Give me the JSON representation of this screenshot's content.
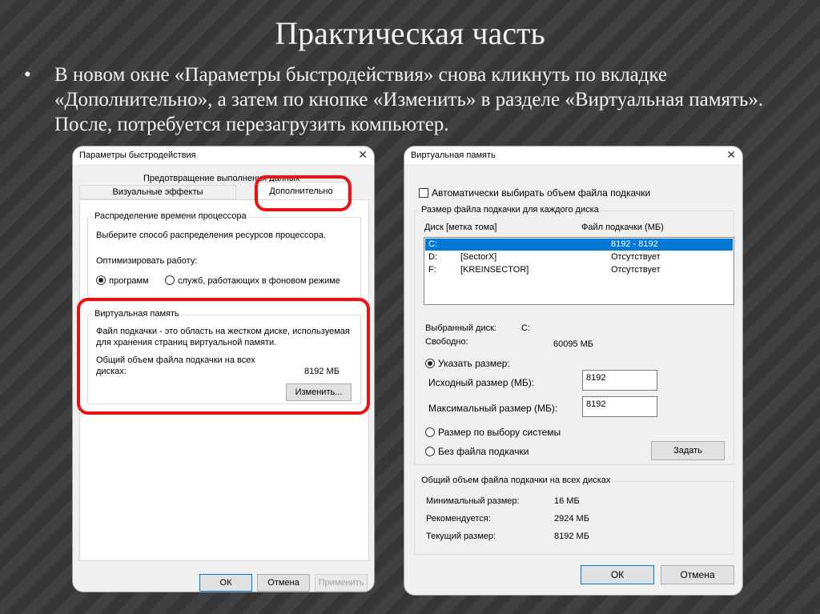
{
  "slide": {
    "title": "Практическая часть",
    "bullet_marker": "•",
    "bullet_text": "В новом окне «Параметры быстродействия» снова кликнуть по вкладке «Дополнительно», а затем по кнопке «Изменить» в разделе «Виртуальная память». После, потребуется перезагрузить компьютер."
  },
  "perf_window": {
    "title": "Параметры быстродействия",
    "close": "✕",
    "tabs": {
      "dep": "Предотвращение выполнения данных",
      "visual": "Визуальные эффекты",
      "advanced": "Дополнительно"
    },
    "cpu_group": {
      "label": "Распределение времени процессора",
      "description": "Выберите способ распределения ресурсов процессора.",
      "optimize_label": "Оптимизировать работу:",
      "option_programs": "программ",
      "option_services": "служб, работающих в фоновом режиме"
    },
    "vm_group": {
      "label": "Виртуальная память",
      "description_line1": "Файл подкачки - это область на жестком диске, используемая",
      "description_line2": "для хранения страниц виртуальной памяти.",
      "total_line1": "Общий объем файла подкачки на всех",
      "total_line2": "дисках:",
      "total_value": "8192 МБ",
      "change_button": "Изменить..."
    },
    "buttons": {
      "ok": "ОК",
      "cancel": "Отмена",
      "apply": "Применить"
    }
  },
  "vm_window": {
    "title": "Виртуальная память",
    "close": "✕",
    "auto_checkbox": "Автоматически выбирать объем файла подкачки",
    "per_drive_group": {
      "label": "Размер файла подкачки для каждого диска",
      "col_drive": "Диск [метка тома]",
      "col_size": "Файл подкачки (МБ)",
      "rows": [
        {
          "drive": "C:",
          "label": "",
          "size": "8192 - 8192",
          "selected": true
        },
        {
          "drive": "D:",
          "label": "[SectorX]",
          "size": "Отсутствует",
          "selected": false
        },
        {
          "drive": "F:",
          "label": "[KREINSECTOR]",
          "size": "Отсутствует",
          "selected": false
        }
      ],
      "selected_drive_label": "Выбранный диск:",
      "selected_drive_value": "C:",
      "free_label": "Свободно:",
      "free_value": "60095 МБ",
      "custom_size_label": "Указать размер:",
      "initial_label": "Исходный размер (МБ):",
      "initial_value": "8192",
      "max_label": "Максимальный размер (МБ):",
      "max_value": "8192",
      "system_size_label": "Размер по выбору системы",
      "no_file_label": "Без файла подкачки",
      "set_button": "Задать"
    },
    "totals_group": {
      "label": "Общий объем файла подкачки на всех дисках",
      "min_label": "Минимальный размер:",
      "min_value": "16 МБ",
      "recommended_label": "Рекомендуется:",
      "recommended_value": "2924 МБ",
      "current_label": "Текущий размер:",
      "current_value": "8192 МБ"
    },
    "buttons": {
      "ok": "ОК",
      "cancel": "Отмена"
    }
  },
  "colors": {
    "highlight": "#e11",
    "selection": "#0078d7",
    "slide_bg": "#3a3a3a"
  }
}
